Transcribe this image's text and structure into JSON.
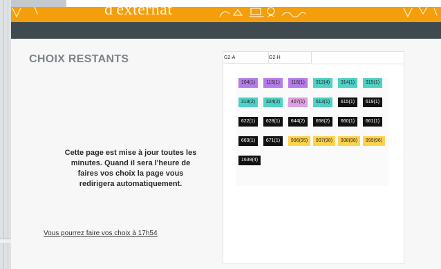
{
  "header": {
    "brand_text": "d'externat",
    "colors": {
      "header": "#f59e0b",
      "navbar": "#3f4a4e"
    }
  },
  "main": {
    "title": "CHOIX RESTANTS",
    "info_lines": [
      "Cette page est mise à jour toutes les",
      "minutes. Quand il sera l'heure de",
      "faires vos choix la page vous",
      "redirigera automatiquement."
    ],
    "time_link": "Vous pourrez faire vos choix à 17h54"
  },
  "panel": {
    "tabs": [
      "G2-A",
      "G2-H"
    ],
    "chips": [
      {
        "label": "104(1)",
        "color": "purple"
      },
      {
        "label": "115(1)",
        "color": "purple"
      },
      {
        "label": "116(1)",
        "color": "purple"
      },
      {
        "label": "312(4)",
        "color": "teal"
      },
      {
        "label": "314(1)",
        "color": "teal"
      },
      {
        "label": "315(1)",
        "color": "teal"
      },
      {
        "label": "319(2)",
        "color": "teal"
      },
      {
        "label": "324(2)",
        "color": "teal"
      },
      {
        "label": "407(1)",
        "color": "pink"
      },
      {
        "label": "513(1)",
        "color": "teal"
      },
      {
        "label": "615(1)",
        "color": "black"
      },
      {
        "label": "619(1)",
        "color": "black"
      },
      {
        "label": "622(1)",
        "color": "black"
      },
      {
        "label": "628(1)",
        "color": "black"
      },
      {
        "label": "644(2)",
        "color": "black"
      },
      {
        "label": "658(2)",
        "color": "black"
      },
      {
        "label": "660(1)",
        "color": "black"
      },
      {
        "label": "661(1)",
        "color": "black"
      },
      {
        "label": "669(1)",
        "color": "black"
      },
      {
        "label": "671(1)",
        "color": "black"
      },
      {
        "label": "996(95)",
        "color": "yellow"
      },
      {
        "label": "997(98)",
        "color": "yellow"
      },
      {
        "label": "998(98)",
        "color": "yellow"
      },
      {
        "label": "999(96)",
        "color": "yellow"
      },
      {
        "label": "1639(4)",
        "color": "black"
      }
    ]
  }
}
